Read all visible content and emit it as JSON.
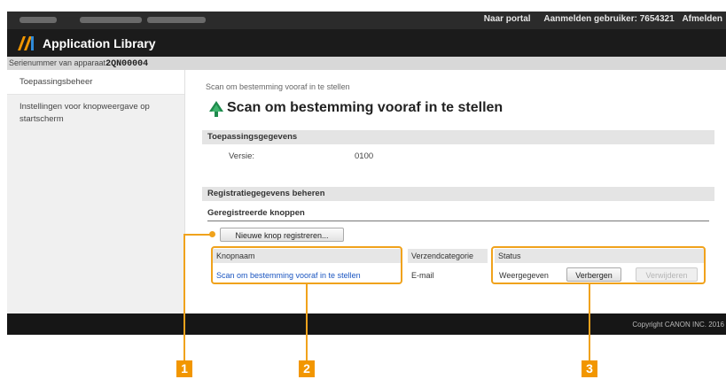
{
  "topbar": {
    "portal_link": "Naar portal",
    "login_user": "Aanmelden gebruiker: 7654321",
    "logout_link": "Afmelden"
  },
  "app": {
    "title": "Application Library"
  },
  "serial": {
    "label": "Serienummer van apparaat",
    "value": "2QN00004"
  },
  "sidebar": {
    "items": [
      {
        "label": "Toepassingsbeheer"
      },
      {
        "label": "Instellingen voor knopweergave op startscherm"
      }
    ]
  },
  "main": {
    "breadcrumb": "Scan om bestemming vooraf in te stellen",
    "title": "Scan om bestemming vooraf in te stellen",
    "app_info_header": "Toepassingsgegevens",
    "version_label": "Versie:",
    "version_value": "0100",
    "registration_header": "Registratiegegevens beheren",
    "registered_buttons_label": "Geregistreerde knoppen",
    "new_button": "Nieuwe knop registreren...",
    "table": {
      "col_name": "Knopnaam",
      "col_category": "Verzendcategorie",
      "col_status": "Status",
      "row": {
        "name": "Scan om bestemming vooraf in te stellen",
        "category": "E-mail",
        "status": "Weergegeven",
        "hide_button": "Verbergen",
        "delete_button": "Verwijderen"
      }
    },
    "to_top_icon": "to-top-icon"
  },
  "footer": {
    "copyright": "Copyright CANON INC. 2016"
  },
  "callouts": [
    "1",
    "2",
    "3"
  ],
  "colors": {
    "accent": "#f29600",
    "link": "#1a55c0",
    "appbar": "#1b1b1b"
  }
}
